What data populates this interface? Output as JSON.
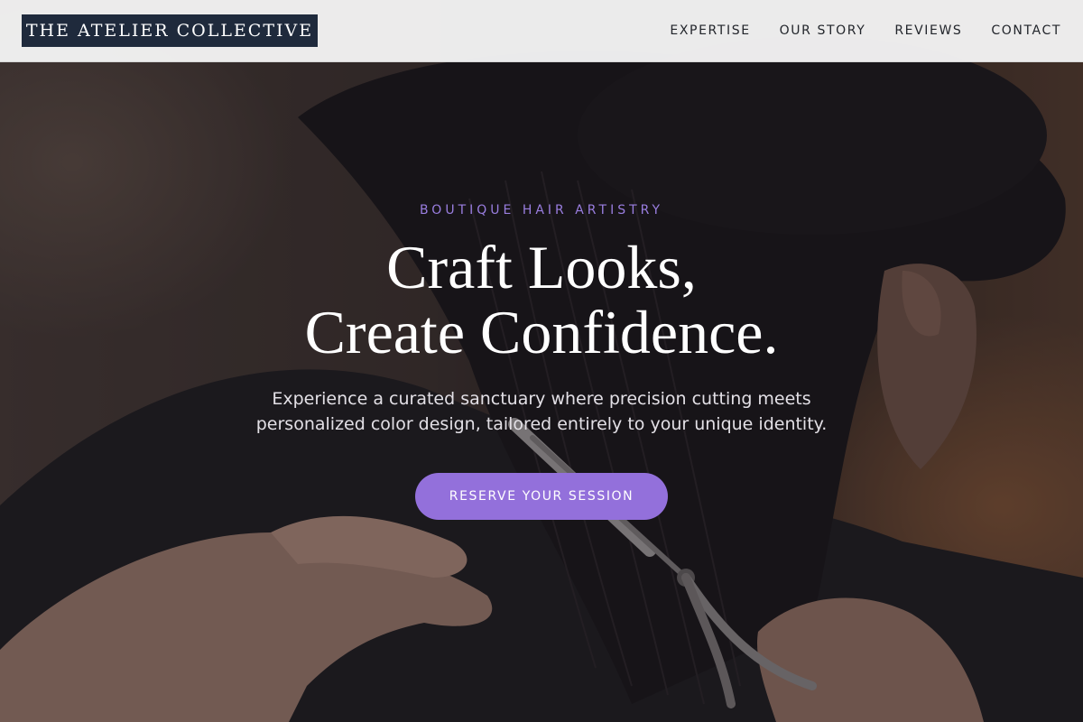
{
  "header": {
    "brand": "THE ATELIER COLLECTIVE",
    "nav": [
      {
        "label": "EXPERTISE"
      },
      {
        "label": "OUR STORY"
      },
      {
        "label": "REVIEWS"
      },
      {
        "label": "CONTACT"
      }
    ]
  },
  "hero": {
    "eyebrow": "BOUTIQUE HAIR ARTISTRY",
    "headline_line1": "Craft Looks,",
    "headline_line2": "Create Confidence.",
    "subtext": "Experience a curated sanctuary where precision cutting meets personalized color design, tailored entirely to your unique identity.",
    "cta_label": "RESERVE YOUR SESSION",
    "background_image": "stylist cutting dark hair with scissors"
  },
  "colors": {
    "header_bg": "#f4f4f4",
    "logo_bg": "#1f2a3c",
    "accent": "#9370db",
    "eyebrow": "#9a7ee0",
    "headline": "#ffffff"
  }
}
